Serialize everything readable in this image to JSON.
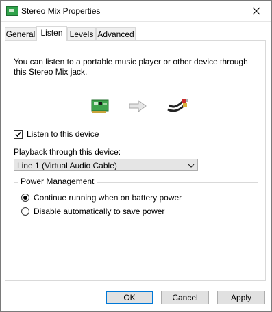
{
  "window": {
    "title": "Stereo Mix Properties"
  },
  "tabs": [
    {
      "label": "General"
    },
    {
      "label": "Listen"
    },
    {
      "label": "Levels"
    },
    {
      "label": "Advanced"
    }
  ],
  "listen": {
    "description": "You can listen to a portable music player or other device through this Stereo Mix jack.",
    "listen_checkbox": {
      "label": "Listen to this device",
      "checked": true
    },
    "playback_label": "Playback through this device:",
    "playback_select": {
      "value": "Line 1 (Virtual Audio Cable)"
    }
  },
  "power_management": {
    "legend": "Power Management",
    "options": [
      {
        "label": "Continue running when on battery power",
        "selected": true
      },
      {
        "label": "Disable automatically to save power",
        "selected": false
      }
    ]
  },
  "footer": {
    "ok_label": "OK",
    "cancel_label": "Cancel",
    "apply_label": "Apply"
  },
  "icons": {
    "app": "sound-card-icon",
    "close": "close-icon",
    "source": "sound-card-icon",
    "arrow": "arrow-right-icon",
    "target": "audio-jack-icon",
    "dropdown": "chevron-down-icon"
  },
  "colors": {
    "accent": "#0078d7",
    "button_bg": "#e1e1e1",
    "panel_border": "#d9d9d9"
  }
}
